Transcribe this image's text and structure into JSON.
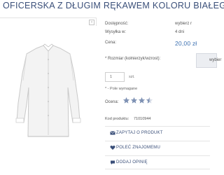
{
  "product": {
    "title": "OFICERSKA Z DŁUGIM RĘKAWEM KOLORU BIAŁEG",
    "availability_label": "Dostępność:",
    "availability_value": "wybierz r",
    "shipping_label": "Wysyłka w:",
    "shipping_value": "4 dni",
    "price_label": "Cena:",
    "price_value": "20,00 zł",
    "size_label": "* Rozmiar (kołnierzyk/wzrost):",
    "size_selected": "wybier",
    "quantity_value": "1",
    "quantity_unit": "szt.",
    "required_note": "* - Pole wymagane",
    "rating_label": "Ocena:",
    "rating_value": 3.5,
    "rating_max": 5,
    "code_label": "Kod produktu:",
    "code_value": "71010944"
  },
  "actions": [
    {
      "label": "ZAPYTAJ O PRODUKT",
      "icon": "envelope-icon"
    },
    {
      "label": "POLEĆ ZNAJOMEMU",
      "icon": "heart-icon"
    },
    {
      "label": "DODAJ OPINIĘ",
      "icon": "chat-bubble-icon"
    }
  ],
  "colors": {
    "accent": "#3a4f79",
    "price": "#3a6fb0",
    "star": "#7f92b4"
  }
}
